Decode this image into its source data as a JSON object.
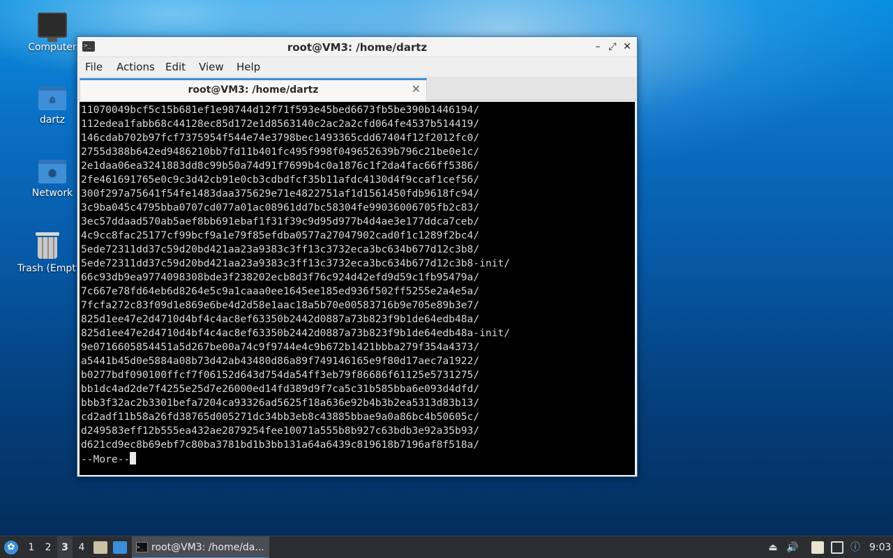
{
  "desktop": {
    "icons": [
      {
        "label": "Computer"
      },
      {
        "label": "dartz"
      },
      {
        "label": "Network"
      },
      {
        "label": "Trash (Empty)"
      }
    ]
  },
  "window": {
    "title": "root@VM3: /home/dartz",
    "menu": [
      "File",
      "Actions",
      "Edit",
      "View",
      "Help"
    ],
    "tab": {
      "title": "root@VM3: /home/dartz"
    },
    "terminal": {
      "lines": [
        "11070049bcf5c15b681ef1e98744d12f71f593e45bed6673fb5be390b1446194/",
        "112edea1fabb68c44128ec85d172e1d8563140c2ac2a2cfd064fe4537b514419/",
        "146cdab702b97fcf7375954f544e74e3798bec1493365cdd67404f12f2012fc0/",
        "2755d388b642ed9486210bb7fd11b401fc495f998f049652639b796c21be0e1c/",
        "2e1daa06ea3241883dd8c99b50a74d91f7699b4c0a1876c1f2da4fac66ff5386/",
        "2fe461691765e0c9c3d42cb91e0cb3cdbdfcf35b11afdc4130d4f9ccaf1cef56/",
        "300f297a75641f54fe1483daa375629e71e4822751af1d1561450fdb9618fc94/",
        "3c9ba045c4795bba0707cd077a01ac08961dd7bc58304fe99036006705fb2c83/",
        "3ec57ddaad570ab5aef8bb691ebaf1f31f39c9d95d977b4d4ae3e177ddca7ceb/",
        "4c9cc8fac25177cf99bcf9a1e79f85efdba0577a27047902cad0f1c1289f2bc4/",
        "5ede72311dd37c59d20bd421aa23a9383c3ff13c3732eca3bc634b677d12c3b8/",
        "5ede72311dd37c59d20bd421aa23a9383c3ff13c3732eca3bc634b677d12c3b8-init/",
        "66c93db9ea9774098308bde3f238202ecb8d3f76c924d42efd9d59c1fb95479a/",
        "7c667e78fd64eb6d8264e5c9a1caaa0ee1645ee185ed936f502ff5255e2a4e5a/",
        "7fcfa272c83f09d1e869e6be4d2d58e1aac18a5b70e00583716b9e705e89b3e7/",
        "825d1ee47e2d4710d4bf4c4ac8ef63350b2442d0887a73b823f9b1de64edb48a/",
        "825d1ee47e2d4710d4bf4c4ac8ef63350b2442d0887a73b823f9b1de64edb48a-init/",
        "9e0716605854451a5d267be00a74c9f9744e4c9b672b1421bbba279f354a4373/",
        "a5441b45d0e5884a08b73d42ab43480d86a89f749146165e9f80d17aec7a1922/",
        "b0277bdf090100ffcf7f06152d643d754da54ff3eb79f86686f61125e5731275/",
        "bb1dc4ad2de7f4255e25d7e26000ed14fd389d9f7ca5c31b585bba6e093d4dfd/",
        "bbb3f32ac2b3301befa7204ca93326ad5625f18a636e92b4b3b2ea5313d83b13/",
        "cd2adf11b58a26fd38765d005271dc34bb3eb8c43885bbae9a0a86bc4b50605c/",
        "d249583eff12b555ea432ae2879254fee10071a555b8b927c63bdb3e92a35b93/",
        "d621cd9ec8b69ebf7c80ba3781bd1b3bb131a64a6439c819618b7196af8f518a/"
      ],
      "pager_prompt": "--More--"
    }
  },
  "taskbar": {
    "workspaces": [
      "1",
      "2",
      "3",
      "4"
    ],
    "active_workspace": "3",
    "task_label": "root@VM3: /home/da...",
    "clock": "9:03"
  }
}
